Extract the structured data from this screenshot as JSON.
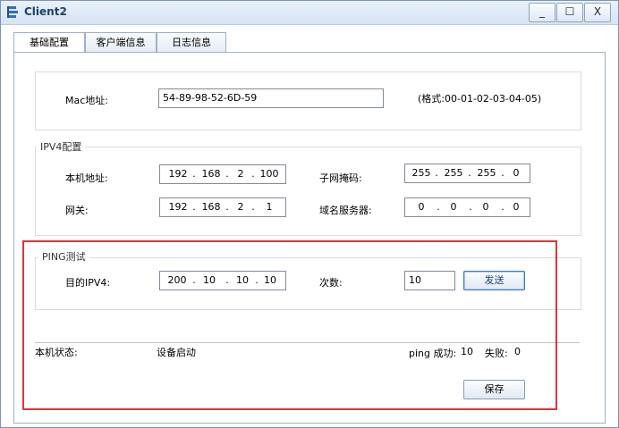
{
  "window": {
    "title": "Client2",
    "controls": [
      "_",
      "☐",
      "X"
    ]
  },
  "tabs": [
    {
      "label": "基础配置",
      "active": true
    },
    {
      "label": "客户端信息",
      "active": false
    },
    {
      "label": "日志信息",
      "active": false
    }
  ],
  "mac": {
    "label": "Mac地址:",
    "value": "54-89-98-52-6D-59",
    "hint": "(格式:00-01-02-03-04-05)"
  },
  "ipv4": {
    "group_label": "IPV4配置",
    "local_label": "本机地址:",
    "local": [
      "192",
      "168",
      "2",
      "100"
    ],
    "mask_label": "子网掩码:",
    "mask": [
      "255",
      "255",
      "255",
      "0"
    ],
    "gateway_label": "网关:",
    "gateway": [
      "192",
      "168",
      "2",
      "1"
    ],
    "dns_label": "域名服务器:",
    "dns": [
      "0",
      "0",
      "0",
      "0"
    ]
  },
  "ping": {
    "group_label": "PING测试",
    "dest_label": "目的IPV4:",
    "dest": [
      "200",
      "10",
      "10",
      "10"
    ],
    "count_label": "次数:",
    "count": "10",
    "send_label": "发送"
  },
  "status": {
    "label": "本机状态:",
    "value": "设备启动",
    "ping_success_label": "ping 成功:",
    "ping_success": "10",
    "fail_label": "失败:",
    "fail": "0"
  },
  "save_label": "保存",
  "colors": {
    "highlight": "#e0343a",
    "title_text": "#1f3f6a"
  }
}
